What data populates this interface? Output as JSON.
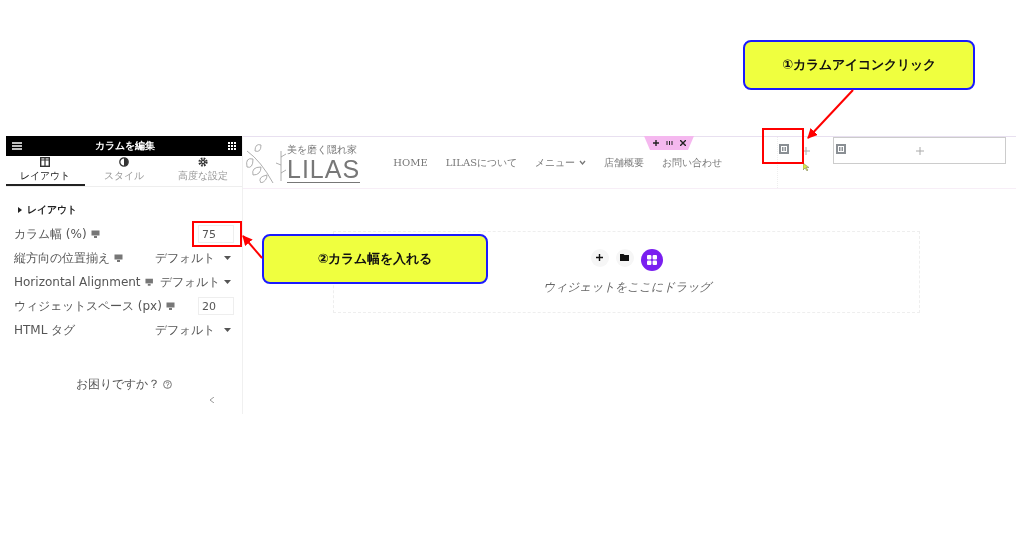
{
  "callouts": [
    {
      "text": "①カラムアイコンクリック"
    },
    {
      "text": "②カラム幅を入れる"
    }
  ],
  "panel": {
    "title": "カラムを編集",
    "tabs": [
      {
        "label": "レイアウト",
        "selected": true,
        "kind": "layout"
      },
      {
        "label": "スタイル",
        "selected": false,
        "kind": "style"
      },
      {
        "label": "高度な設定",
        "selected": false,
        "kind": "advanced"
      }
    ],
    "section": {
      "title": "レイアウト",
      "expanded": true
    },
    "controls": [
      {
        "kind": "number",
        "label": "カラム幅 (%)",
        "responsive": true,
        "value": "75"
      },
      {
        "kind": "select",
        "label": "縦方向の位置揃え",
        "responsive": true,
        "value": "デフォルト"
      },
      {
        "kind": "select",
        "label": "Horizontal Alignment",
        "responsive": true,
        "value": "デフォルト"
      },
      {
        "kind": "number",
        "label": "ウィジェットスペース (px)",
        "responsive": true,
        "value": "20"
      },
      {
        "kind": "select",
        "label": "HTML タグ",
        "responsive": false,
        "value": "デフォルト"
      }
    ],
    "help": "お困りですか？"
  },
  "site": {
    "tagline": "美を磨く隠れ家",
    "logo": "LILAS",
    "nav": [
      {
        "label": "HOME",
        "dropdown": false
      },
      {
        "label": "LILASについて",
        "dropdown": false
      },
      {
        "label": "メニュー",
        "dropdown": true
      },
      {
        "label": "店舗概要",
        "dropdown": false
      },
      {
        "label": "お問い合わせ",
        "dropdown": false
      }
    ]
  },
  "dropzone": {
    "text": "ウィジェットをここにドラッグ"
  }
}
